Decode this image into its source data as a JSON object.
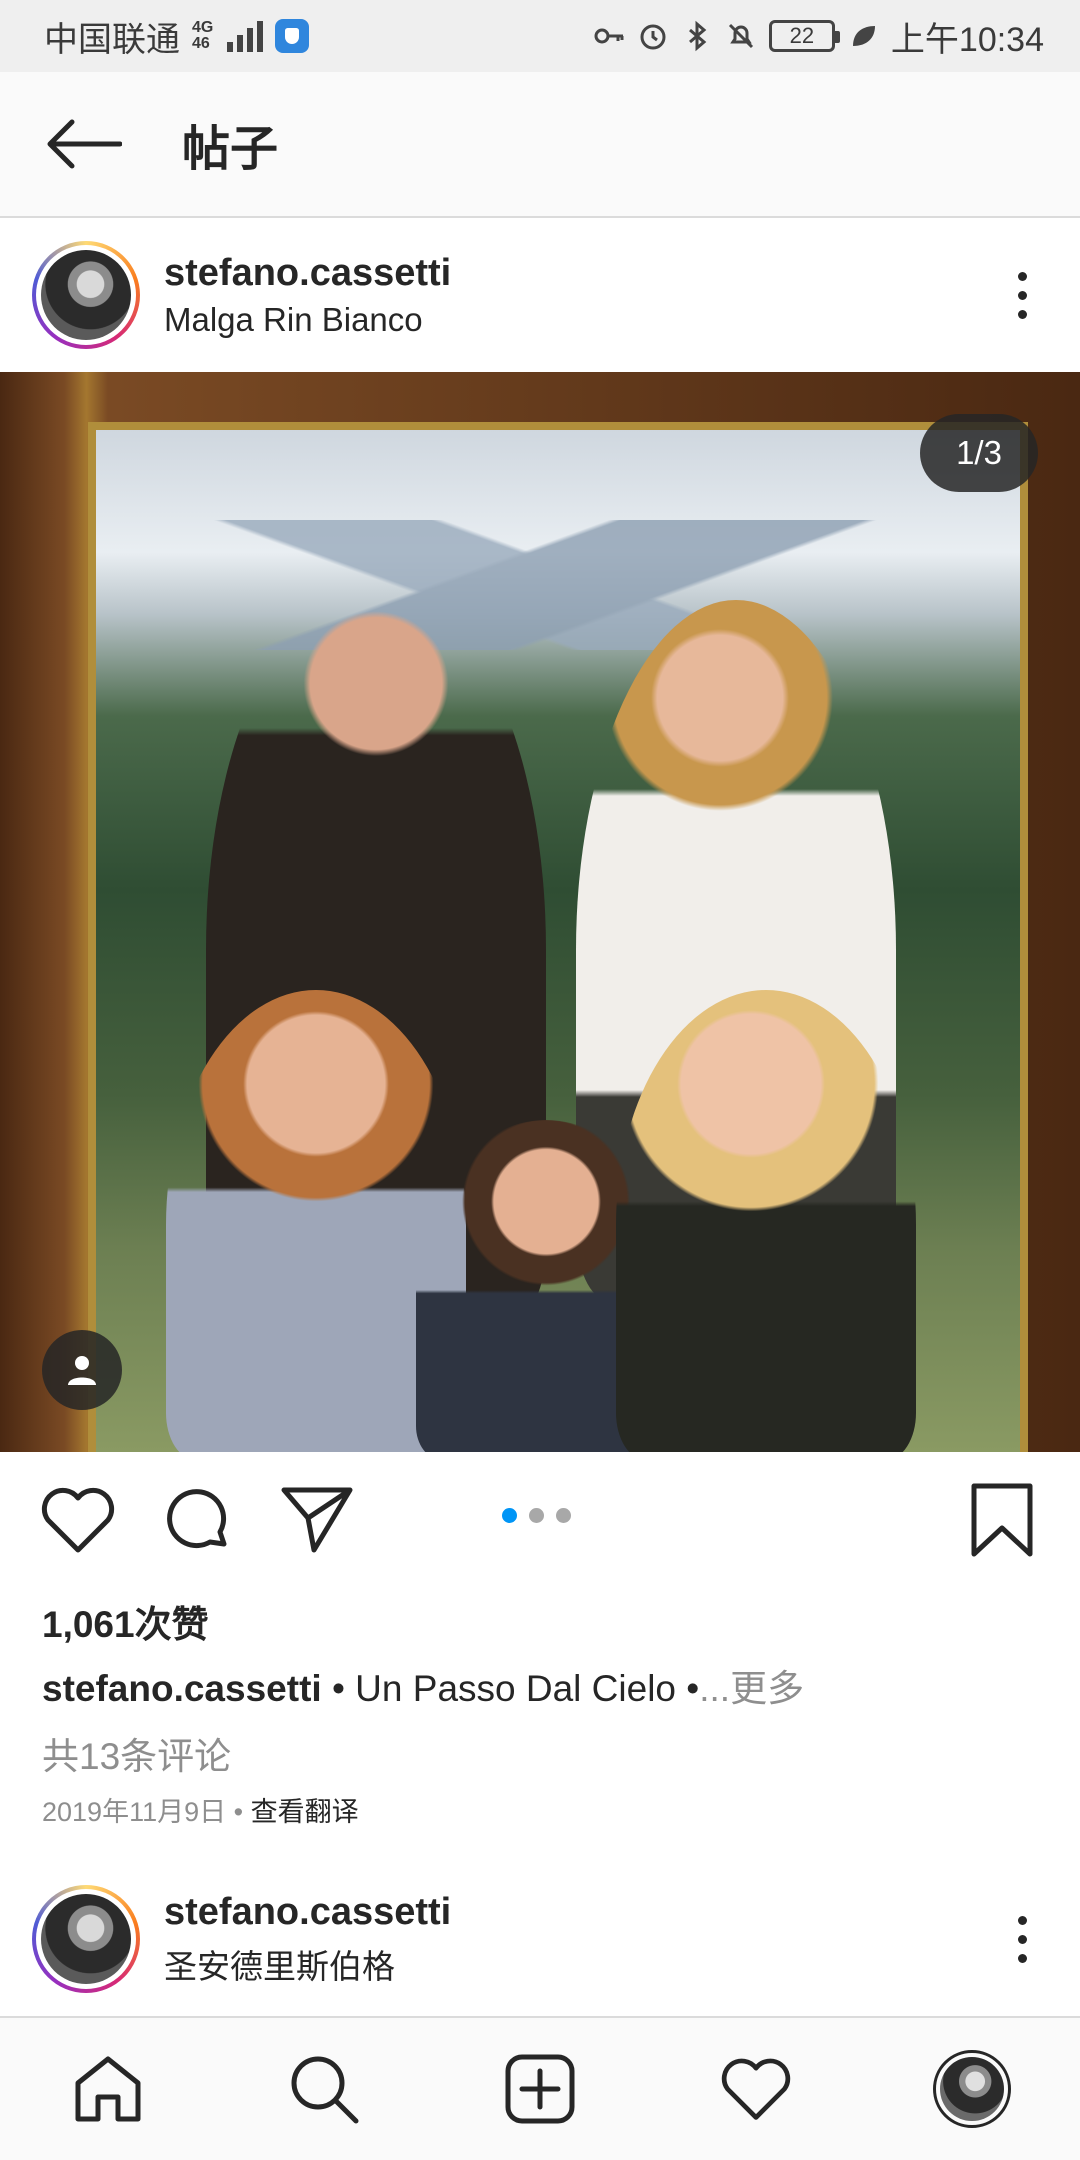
{
  "status_bar": {
    "carrier": "中国联通",
    "network": "4G",
    "network_sub": "46",
    "battery": "22",
    "time": "上午10:34"
  },
  "header": {
    "title": "帖子",
    "back_icon": "arrow-left-icon"
  },
  "post": {
    "username": "stefano.cassetti",
    "location": "Malga Rin Bianco",
    "image_counter": "1/3",
    "carousel": {
      "count": 3,
      "active": 1
    },
    "likes": "1,061次赞",
    "caption_user": "stefano.cassetti",
    "caption_text": " • Un Passo Dal Cielo •",
    "caption_more": "...更多",
    "comments": "共13条评论",
    "date": "2019年11月9日",
    "separator": " • ",
    "translate": "查看翻译"
  },
  "next_post": {
    "username": "stefano.cassetti",
    "location": "圣安德里斯伯格"
  },
  "bottom_nav": {
    "items": [
      "home-icon",
      "search-icon",
      "add-post-icon",
      "activity-heart-icon",
      "profile-avatar"
    ]
  },
  "colors": {
    "accent_blue": "#0095f6",
    "text_primary": "#262626",
    "text_secondary": "#8e8e8e"
  }
}
